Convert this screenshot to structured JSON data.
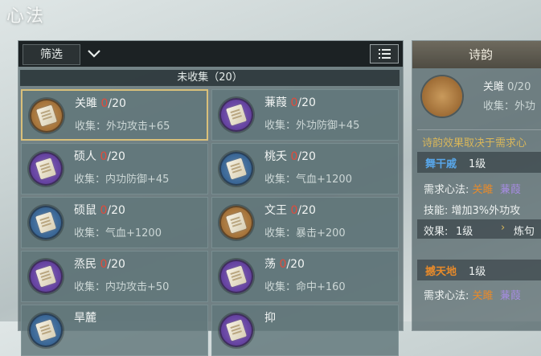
{
  "page_title": "心法",
  "toolbar": {
    "filter_label": "筛选"
  },
  "list_header": "未收集（20）",
  "cards": [
    {
      "name": "关雎",
      "current": "0",
      "total": "/20",
      "effect": "收集：外功攻击+65",
      "color": "orange",
      "selected": true
    },
    {
      "name": "蒹葭",
      "current": "0",
      "total": "/20",
      "effect": "收集：外功防御+45",
      "color": "purple",
      "selected": false
    },
    {
      "name": "硕人",
      "current": "0",
      "total": "/20",
      "effect": "收集：内功防御+45",
      "color": "purple",
      "selected": false
    },
    {
      "name": "桃夭",
      "current": "0",
      "total": "/20",
      "effect": "收集：气血+1200",
      "color": "blue",
      "selected": false
    },
    {
      "name": "硕鼠",
      "current": "0",
      "total": "/20",
      "effect": "收集：气血+1200",
      "color": "blue",
      "selected": false
    },
    {
      "name": "文王",
      "current": "0",
      "total": "/20",
      "effect": "收集：暴击+200",
      "color": "orange",
      "selected": false
    },
    {
      "name": "烝民",
      "current": "0",
      "total": "/20",
      "effect": "收集：内功攻击+50",
      "color": "purple",
      "selected": false
    },
    {
      "name": "荡",
      "current": "0",
      "total": "/20",
      "effect": "收集：命中+160",
      "color": "purple",
      "selected": false
    },
    {
      "name": "旱麓",
      "current": "",
      "total": "",
      "effect": "",
      "color": "blue",
      "selected": false
    },
    {
      "name": "抑",
      "current": "",
      "total": "",
      "effect": "",
      "color": "purple",
      "selected": false
    }
  ],
  "right_panel": {
    "title": "诗韵",
    "item_name": "关雎",
    "item_count": "0/20",
    "item_effect": "收集：外功",
    "note": "诗韵效果取决于需求心",
    "set1": {
      "name": "舞干戚",
      "level": "1级",
      "req_label": "需求心法:",
      "req_a": "关雎",
      "req_b": "蒹葭",
      "skill_label": "技能:",
      "skill_text": "增加3%外功攻",
      "effect_label": "效果:",
      "effect_level": "1级",
      "effect_extra": "炼句"
    },
    "set2": {
      "name": "撼天地",
      "level": "1级",
      "req_label": "需求心法:",
      "req_a": "关雎",
      "req_b": "蒹葭"
    }
  },
  "colors": {
    "count_red": "#e24b3b",
    "gold": "#d8b65a",
    "blue": "#58a6e8",
    "selected_border": "#d9c07a"
  }
}
